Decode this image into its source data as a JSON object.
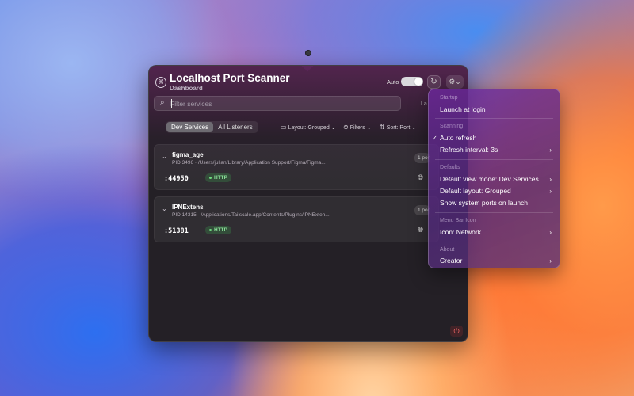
{
  "header": {
    "title": "Localhost Port Scanner",
    "subtitle": "Dashboard",
    "auto_label": "Auto",
    "auto_enabled": true,
    "settings_glyph": "⚙︎⌄"
  },
  "search": {
    "placeholder": "Filter services"
  },
  "la_text": "La",
  "tabs": [
    {
      "label": "Dev Services",
      "active": true
    },
    {
      "label": "All Listeners",
      "active": false
    }
  ],
  "toolbar": {
    "layout_label": "Layout: Grouped",
    "filters_label": "Filters",
    "sort_label": "Sort: Port"
  },
  "services": [
    {
      "name": "figma_age",
      "meta": "PID 3496 · /Users/julian/Library/Application Support/Figma/Figma...",
      "port": ":44950",
      "badge": "HTTP",
      "count": "1 port"
    },
    {
      "name": "IPNExtens",
      "meta": "PID 14315 · /Applications/Tailscale.app/Contents/PlugIns/IPNExten...",
      "port": ":51381",
      "badge": "HTTP",
      "count": "1 port"
    }
  ],
  "menu": {
    "startup": {
      "header": "Startup",
      "items": [
        "Launch at login"
      ]
    },
    "scanning": {
      "header": "Scanning",
      "auto_refresh": "Auto refresh",
      "refresh_interval": "Refresh interval: 3s"
    },
    "defaults": {
      "header": "Defaults",
      "view_mode": "Default view mode: Dev Services",
      "layout": "Default layout: Grouped",
      "system_ports": "Show system ports on launch"
    },
    "menubar": {
      "header": "Menu Bar Icon",
      "icon": "Icon: Network"
    },
    "about": {
      "header": "About",
      "creator": "Creator"
    }
  },
  "colors": {
    "accent_green": "#8be39a",
    "power_red": "#ff6a6a",
    "menu_purple": "#6e2aa0"
  }
}
